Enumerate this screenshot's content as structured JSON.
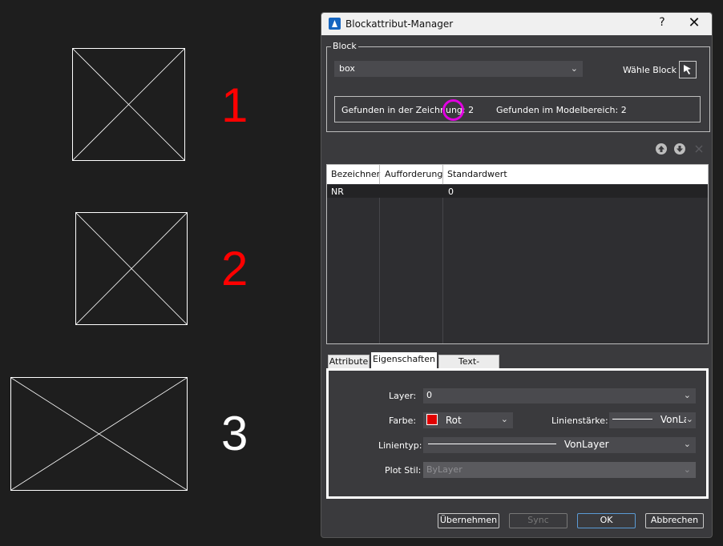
{
  "canvas": {
    "labels": [
      "1",
      "2",
      "3"
    ],
    "label_colors": [
      "#ff0000",
      "#ff0000",
      "#ffffff"
    ]
  },
  "dialog": {
    "title": "Blockattribut-Manager",
    "help": "?",
    "close": "✕"
  },
  "block_group": {
    "label": "Block",
    "selected_block": "box",
    "select_block_label": "Wähle Block",
    "found_in_drawing": "Gefunden in der Zeichnung: 2",
    "found_in_model": "Gefunden im Modelbereich: 2"
  },
  "table": {
    "headers": [
      "Bezeichner",
      "Aufforderung",
      "Standardwert"
    ],
    "rows": [
      {
        "tag": "NR",
        "prompt": "",
        "default": "0"
      }
    ]
  },
  "tabs": [
    "Attribute",
    "Eigenschaften",
    "Text-Optionen"
  ],
  "active_tab": "Eigenschaften",
  "properties": {
    "layer_label": "Layer:",
    "layer_value": "0",
    "color_label": "Farbe:",
    "color_value": "Rot",
    "color_swatch": "#e00000",
    "lineweight_label": "Linienstärke:",
    "lineweight_value": "VonLa",
    "linetype_label": "Linientyp:",
    "linetype_value": "VonLayer",
    "plotstyle_label": "Plot Stil:",
    "plotstyle_value": "ByLayer"
  },
  "buttons": {
    "apply": "Übernehmen",
    "sync": "Sync",
    "ok": "OK",
    "cancel": "Abbrechen"
  },
  "annotation_color": "#e000e0"
}
